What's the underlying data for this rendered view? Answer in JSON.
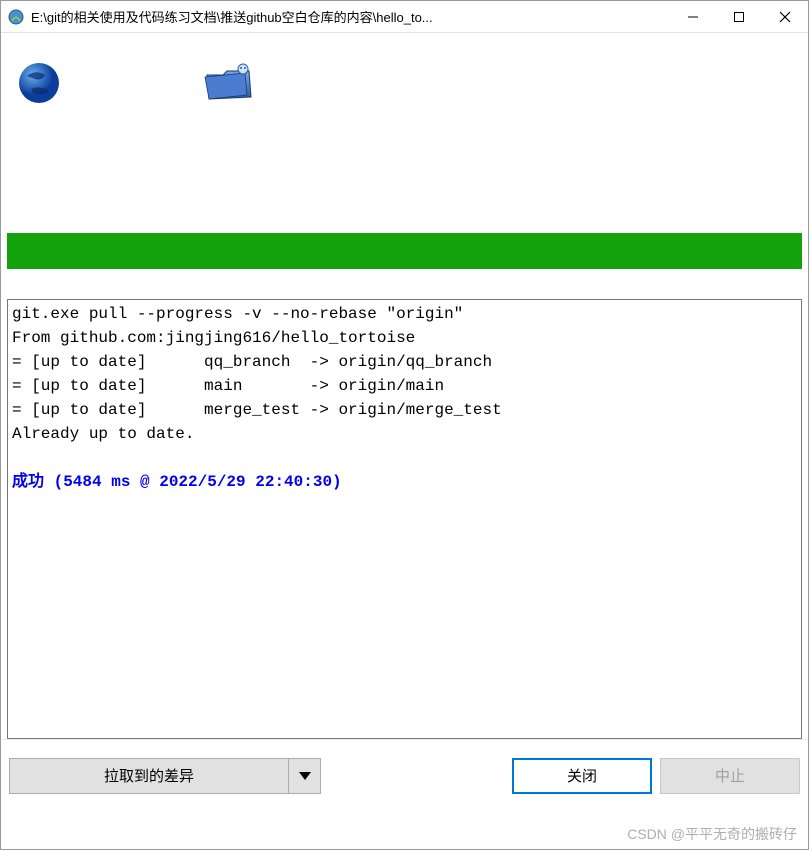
{
  "titlebar": {
    "title": "E:\\git的相关使用及代码练习文档\\推送github空白仓库的内容\\hello_to..."
  },
  "output": {
    "lines": [
      "git.exe pull --progress -v --no-rebase \"origin\"",
      "From github.com:jingjing616/hello_tortoise",
      "= [up to date]      qq_branch  -> origin/qq_branch",
      "= [up to date]      main       -> origin/main",
      "= [up to date]      merge_test -> origin/merge_test",
      "Already up to date."
    ],
    "success": "成功 (5484 ms @ 2022/5/29 22:40:30)"
  },
  "buttons": {
    "pull_diff": "拉取到的差异",
    "close": "关闭",
    "abort": "中止"
  },
  "watermark": "CSDN @平平无奇的搬砖仔"
}
